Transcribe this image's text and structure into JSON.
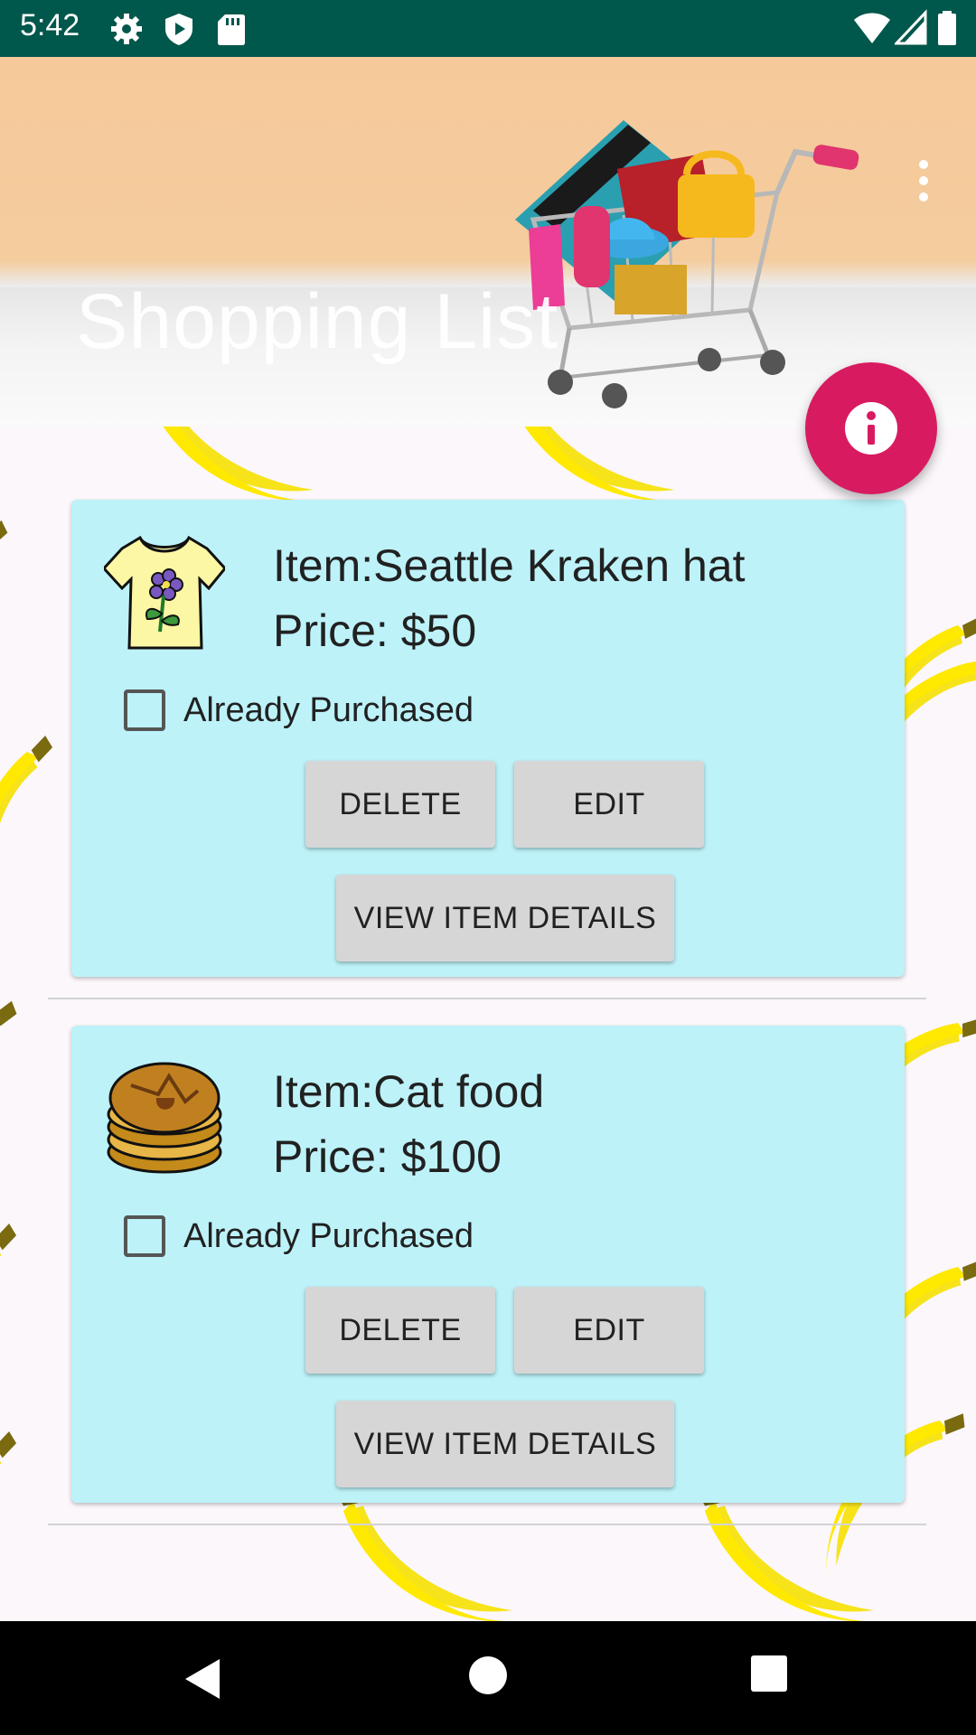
{
  "status_bar": {
    "time": "5:42",
    "left_icons": [
      "settings-icon",
      "play-protect-icon",
      "sd-card-icon"
    ],
    "right_icons": [
      "wifi-icon",
      "cell-signal-icon",
      "battery-icon"
    ]
  },
  "header": {
    "title": "Shopping List",
    "menu_icon": "more-vert-icon"
  },
  "fab": {
    "icon": "info-icon",
    "color": "#d81b60"
  },
  "items": [
    {
      "name": "Item:Seattle Kraken hat",
      "price": "Price: $50",
      "image_icon": "t-shirt-icon",
      "checkbox_label": "Already Purchased",
      "checked": false,
      "delete_label": "DELETE",
      "edit_label": "EDIT",
      "view_label": "VIEW ITEM DETAILS"
    },
    {
      "name": "Item:Cat food",
      "price": "Price: $100",
      "image_icon": "pancakes-icon",
      "checkbox_label": "Already Purchased",
      "checked": false,
      "delete_label": "DELETE",
      "edit_label": "EDIT",
      "view_label": "VIEW ITEM DETAILS"
    }
  ],
  "colors": {
    "status_bar": "#00574b",
    "card": "#bdf2f9",
    "button": "#d6d6d6",
    "accent": "#d81b60"
  },
  "nav_bar": {
    "icons": [
      "back-icon",
      "home-icon",
      "recents-icon"
    ]
  }
}
